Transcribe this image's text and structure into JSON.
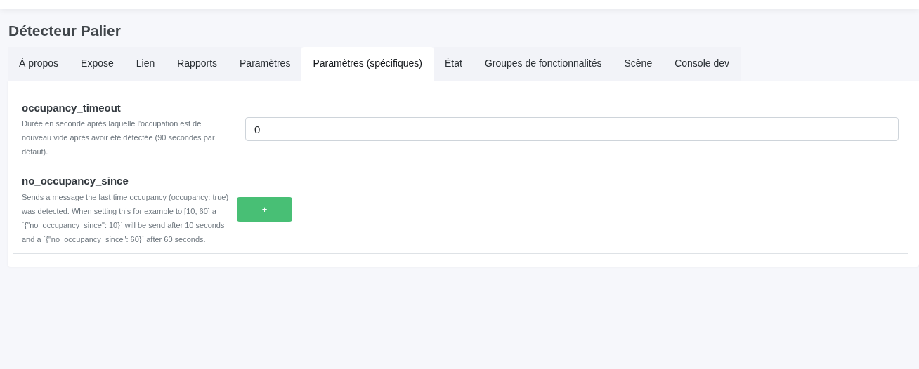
{
  "title": "Détecteur Palier",
  "tabs": [
    {
      "label": "À propos",
      "selected": false
    },
    {
      "label": "Expose",
      "selected": false
    },
    {
      "label": "Lien",
      "selected": false
    },
    {
      "label": "Rapports",
      "selected": false
    },
    {
      "label": "Paramètres",
      "selected": false
    },
    {
      "label": "Paramètres (spécifiques)",
      "selected": true
    },
    {
      "label": "État",
      "selected": false
    },
    {
      "label": "Groupes de fonctionnalités",
      "selected": false
    },
    {
      "label": "Scène",
      "selected": false
    },
    {
      "label": "Console dev",
      "selected": false
    }
  ],
  "settings": [
    {
      "kind": "number",
      "name": "occupancy_timeout",
      "description": "Durée en seconde après laquelle l'occupation est de nouveau vide après avoir été détectée (90 secondes par défaut).",
      "value": "0"
    },
    {
      "kind": "list",
      "name": "no_occupancy_since",
      "description": "Sends a message the last time occupancy (occupancy: true) was detected. When setting this for example to [10, 60] a `{\"no_occupancy_since\": 10}` will be send after 10 seconds and a `{\"no_occupancy_since\": 60}` after 60 seconds.",
      "button": "+"
    }
  ]
}
